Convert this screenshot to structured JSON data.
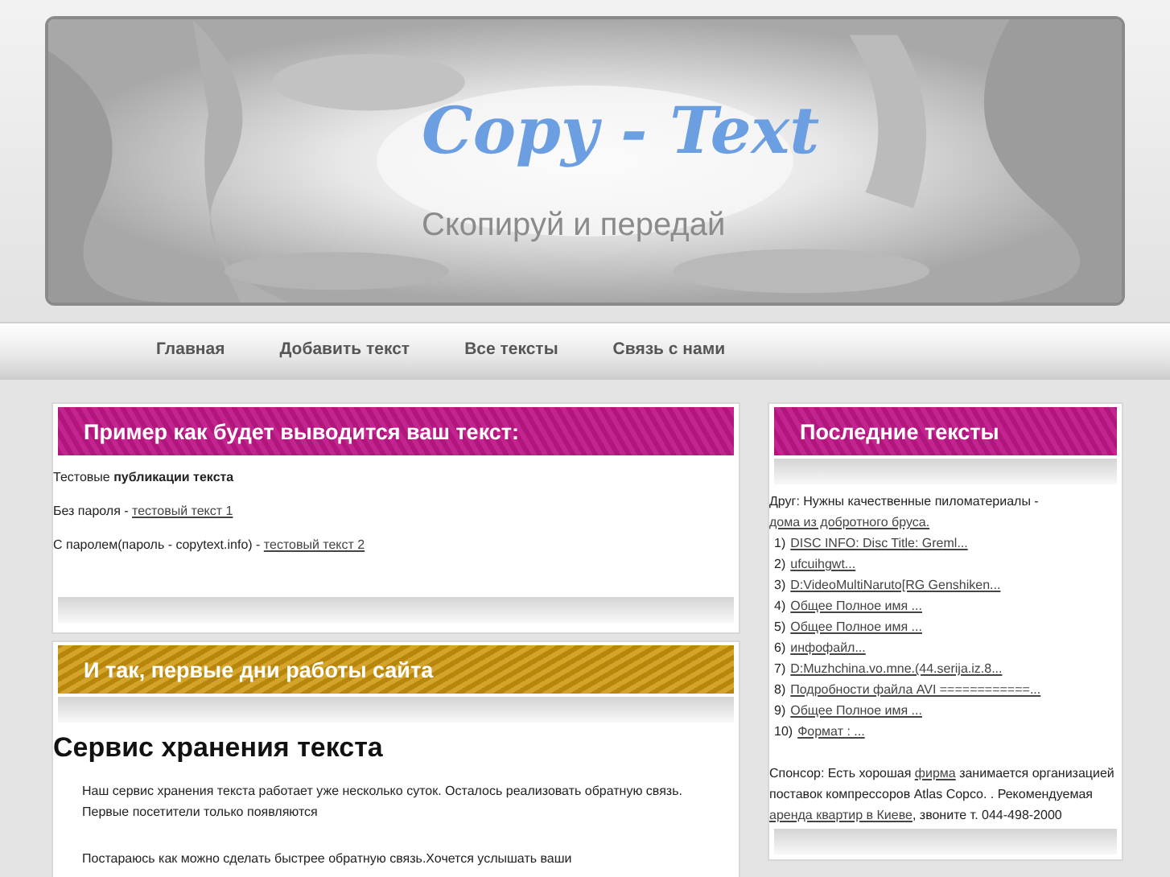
{
  "header": {
    "logo": "Copy - Text",
    "tagline": "Скопируй и передай"
  },
  "nav": [
    {
      "label": "Главная"
    },
    {
      "label": "Добавить текст"
    },
    {
      "label": "Все тексты"
    },
    {
      "label": "Связь с нами"
    }
  ],
  "main": [
    {
      "title": "Пример как будет выводится ваш текст:",
      "paragraphs": [
        [
          {
            "text": "Тестовые **публикации текста**"
          }
        ],
        [
          {
            "text": "Без пароля - "
          },
          {
            "link": "тестовый текст 1"
          }
        ],
        [
          {
            "text": "С паролем(пароль - copytext.info) - "
          },
          {
            "link": "тестовый текст 2"
          }
        ]
      ]
    },
    {
      "title": "И так, первые дни работы сайта",
      "heading": "Сервис хранения текста",
      "paragraphs": [
        [
          {
            "text": "Наш сервис хранения текста работает уже несколько суток. Осталось реализовать обратную связь. Первые посетители только появляются"
          }
        ],
        [
          {
            "text": "Постараюсь как можно сделать быстрее обратную связь.Хочется услышать ваши"
          }
        ]
      ]
    }
  ],
  "sidebar": {
    "title": "Последние тексты",
    "intro": [
      {
        "text": "Друг: Нужны качественные пиломатериалы - "
      },
      {
        "link": "дома из добротного бруса."
      }
    ],
    "items": [
      {
        "number": "1)",
        "link": "DISC INFO: Disc Title: Greml..."
      },
      {
        "number": "2)",
        "link": "ufcuihgwt..."
      },
      {
        "number": "3)",
        "link": "D:VideoMultiNaruto[RG Genshiken..."
      },
      {
        "number": "4)",
        "link": "Общее Полное имя ..."
      },
      {
        "number": "5)",
        "link": "Общее Полное имя ..."
      },
      {
        "number": "6)",
        "link": "инфофайл..."
      },
      {
        "number": "7)",
        "link": "D:Muzhchina.vo.mne.(44.serija.iz.8..."
      },
      {
        "number": "8)",
        "link": "Подробности файла AVI ============..."
      },
      {
        "number": "9)",
        "link": "Общее Полное имя ..."
      },
      {
        "number": "10)",
        "link": "Формат : ..."
      }
    ],
    "sponsor": [
      {
        "text": "Спонсор: Есть хорошая "
      },
      {
        "link": "фирма"
      },
      {
        "text": " занимается организацией поставок компрессоров Atlas Copco. . Рекомендуемая "
      },
      {
        "link": "аренда квартир в Киеве"
      },
      {
        "text": ", звоните т. 044-498-2000"
      }
    ]
  }
}
